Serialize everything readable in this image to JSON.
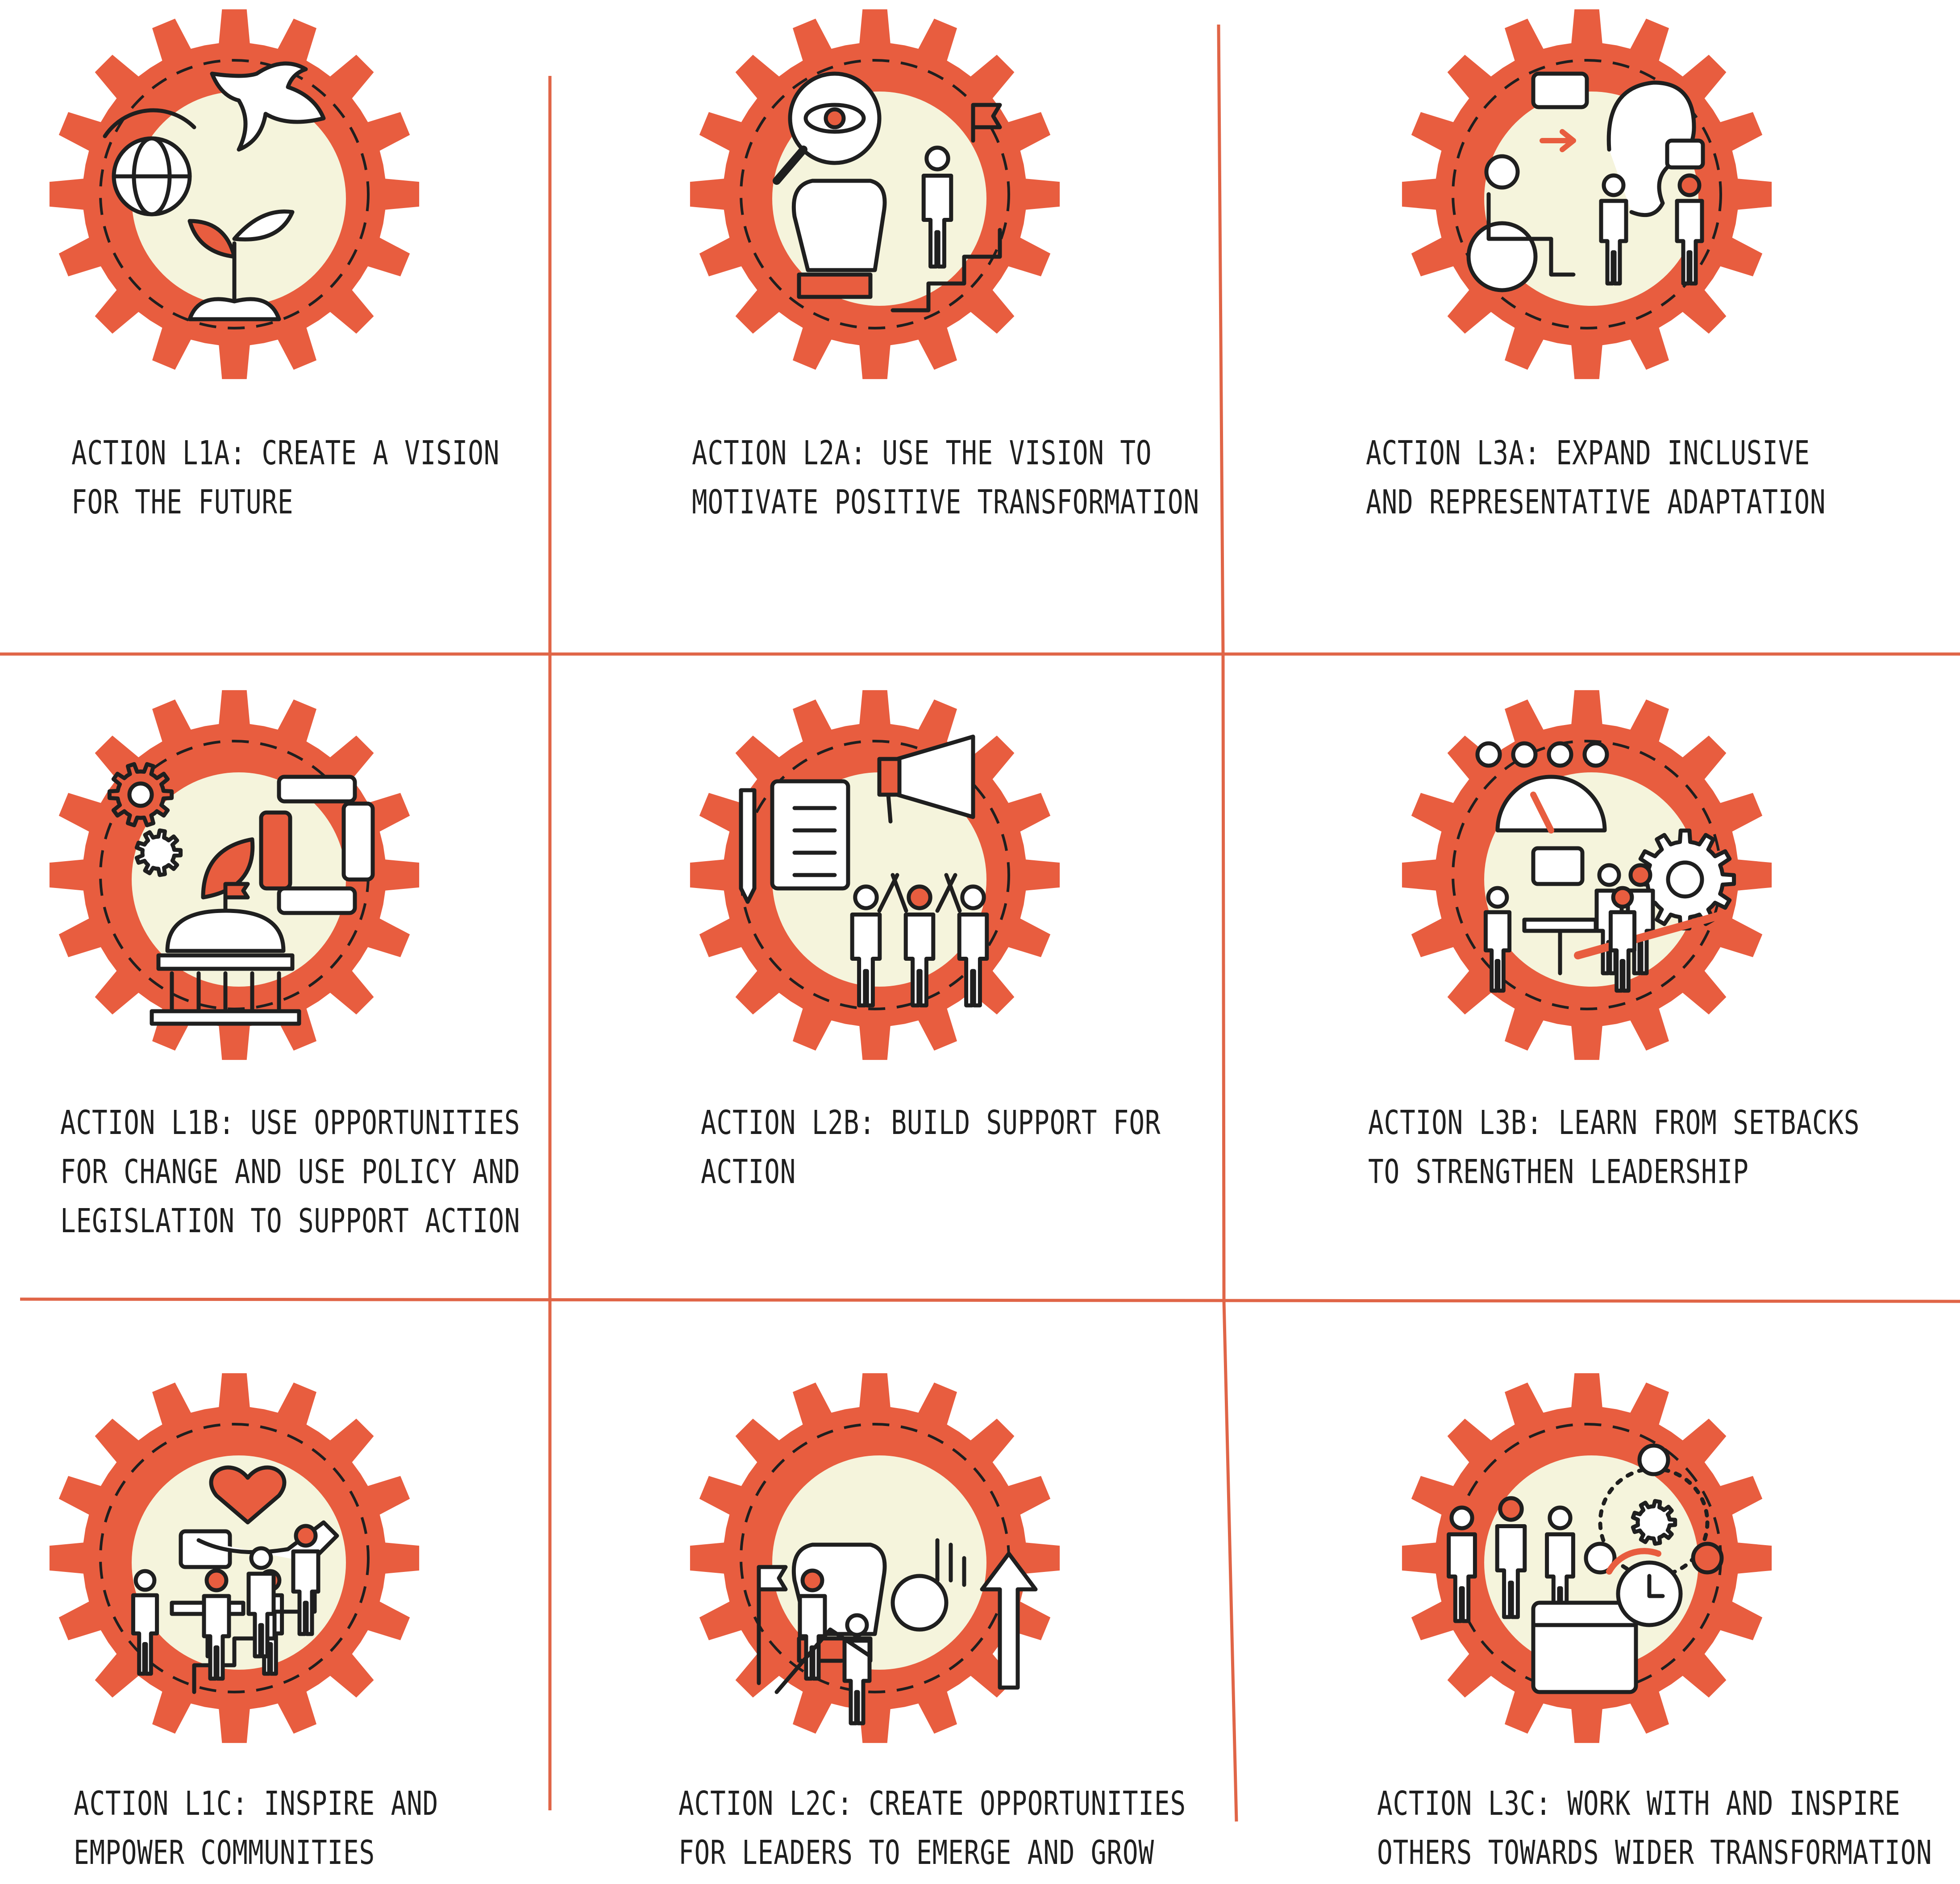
{
  "colors": {
    "accent": "#e85d3f",
    "cream": "#f5f4dc",
    "ink": "#1f1f1f",
    "divider": "#e06547"
  },
  "cells": [
    {
      "id": "l1a",
      "lines": [
        "ACTION L1A: CREATE A VISION",
        "FOR THE FUTURE"
      ],
      "icons": [
        "dove-icon",
        "globe-icon",
        "seedling-icon"
      ]
    },
    {
      "id": "l2a",
      "lines": [
        "ACTION L2A: USE THE VISION TO",
        "MOTIVATE POSITIVE TRANSFORMATION"
      ],
      "icons": [
        "magnifier-eye-icon",
        "raised-fist-icon",
        "person-climbing-stairs-icon"
      ]
    },
    {
      "id": "l3a",
      "lines": [
        "ACTION L3A: EXPAND INCLUSIVE",
        "AND REPRESENTATIVE ADAPTATION"
      ],
      "icons": [
        "speech-bubble-icon",
        "ear-icon",
        "wheelchair-user-icon",
        "people-talking-icon"
      ]
    },
    {
      "id": "l1b",
      "lines": [
        "ACTION L1B: USE OPPORTUNITIES",
        "FOR CHANGE AND USE POLICY AND",
        "LEGISLATION TO SUPPORT ACTION"
      ],
      "icons": [
        "gears-icon",
        "leaf-icon",
        "joined-hands-icon",
        "government-building-icon"
      ]
    },
    {
      "id": "l2b",
      "lines": [
        "ACTION L2B: BUILD SUPPORT FOR",
        "ACTION"
      ],
      "icons": [
        "checklist-icon",
        "pencil-icon",
        "megaphone-icon",
        "cheering-group-icon"
      ]
    },
    {
      "id": "l3b",
      "lines": [
        "ACTION L3B: LEARN FROM SETBACKS",
        "TO STRENGTHEN LEADERSHIP"
      ],
      "icons": [
        "gauge-icon",
        "people-pushing-gear-icon",
        "meeting-table-icon"
      ]
    },
    {
      "id": "l1c",
      "lines": [
        "ACTION L1C: INSPIRE AND",
        "EMPOWER COMMUNITIES"
      ],
      "icons": [
        "meeting-table-icon",
        "heart-in-hand-icon",
        "people-climbing-stairs-icon"
      ]
    },
    {
      "id": "l2c",
      "lines": [
        "ACTION L2C: CREATE OPPORTUNITIES",
        "FOR LEADERS TO EMERGE AND GROW"
      ],
      "icons": [
        "raised-fist-icon",
        "ok-hand-icon",
        "growth-arrow-icon",
        "climbers-flag-icon"
      ]
    },
    {
      "id": "l3c",
      "lines": [
        "ACTION L3C: WORK WITH AND INSPIRE",
        "OTHERS TOWARDS WIDER TRANSFORMATION"
      ],
      "icons": [
        "team-group-icon",
        "network-gear-icon",
        "calendar-clock-icon"
      ]
    }
  ]
}
